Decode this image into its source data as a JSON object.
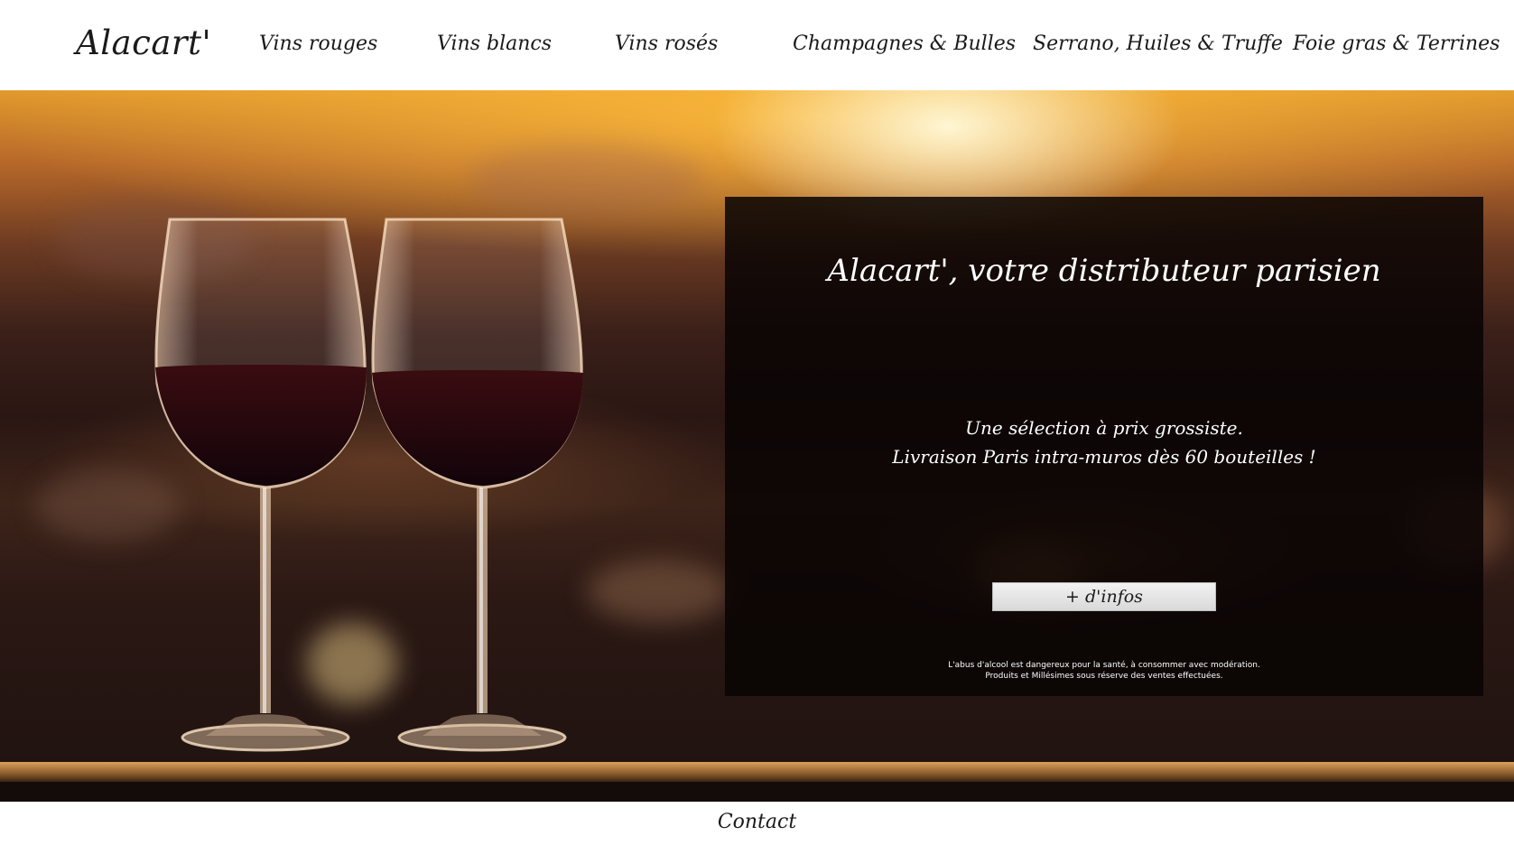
{
  "header": {
    "logo": "Alacart'",
    "nav": [
      {
        "label": "Vins rouges"
      },
      {
        "label": "Vins blancs"
      },
      {
        "label": "Vins rosés"
      },
      {
        "label": "Champagnes & Bulles"
      },
      {
        "label": "Serrano, Huiles & Truffe"
      },
      {
        "label": "Foie gras & Terrines"
      }
    ]
  },
  "hero": {
    "panel": {
      "title": "Alacart', votre distributeur parisien",
      "tagline_line1": "Une sélection à prix grossiste.",
      "tagline_line2": "Livraison Paris intra-muros dès 60 bouteilles !",
      "button_label": "+ d'infos",
      "legal_line1": "L'abus d'alcool est dangereux pour la santé, à consommer avec modération.",
      "legal_line2": "Produits et Millésimes sous réserve des ventes effectuées."
    }
  },
  "footer": {
    "contact_label": "Contact"
  },
  "colors": {
    "panel_background": "#080303",
    "text_dark": "#1a1a1a",
    "text_light": "#ffffff",
    "sunset_accent": "#e29a2c"
  }
}
